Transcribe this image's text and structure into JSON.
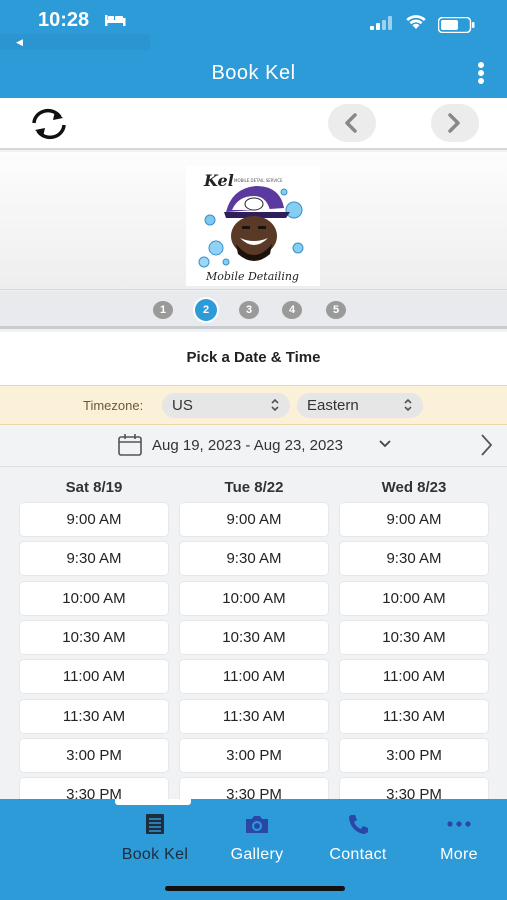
{
  "status": {
    "time": "10:28",
    "back_hint": "◀"
  },
  "header": {
    "title": "Book Kel"
  },
  "steps": [
    "1",
    "2",
    "3",
    "4",
    "5"
  ],
  "active_step": 2,
  "section_title": "Pick a Date & Time",
  "timezone": {
    "label": "Timezone:",
    "region": "US",
    "zone": "Eastern"
  },
  "date_range": "Aug 19, 2023 - Aug 23, 2023",
  "columns": [
    {
      "heading": "Sat 8/19",
      "slots": [
        "9:00 AM",
        "9:30 AM",
        "10:00 AM",
        "10:30 AM",
        "11:00 AM",
        "11:30 AM",
        "3:00 PM",
        "3:30 PM"
      ]
    },
    {
      "heading": "Tue 8/22",
      "slots": [
        "9:00 AM",
        "9:30 AM",
        "10:00 AM",
        "10:30 AM",
        "11:00 AM",
        "11:30 AM",
        "3:00 PM",
        "3:30 PM"
      ]
    },
    {
      "heading": "Wed 8/23",
      "slots": [
        "9:00 AM",
        "9:30 AM",
        "10:00 AM",
        "10:30 AM",
        "11:00 AM",
        "11:30 AM",
        "3:00 PM",
        "3:30 PM"
      ]
    }
  ],
  "bottom_nav": {
    "items": [
      {
        "label": "Book Kel",
        "icon": "book-icon"
      },
      {
        "label": "Gallery",
        "icon": "camera-icon"
      },
      {
        "label": "Contact",
        "icon": "phone-icon"
      },
      {
        "label": "More",
        "icon": "more-dots-icon"
      }
    ],
    "active": 0
  },
  "colors": {
    "primary": "#2c9bd8",
    "timezone_bg": "#fbf1d8",
    "nav_icon": "#2a47a8"
  }
}
